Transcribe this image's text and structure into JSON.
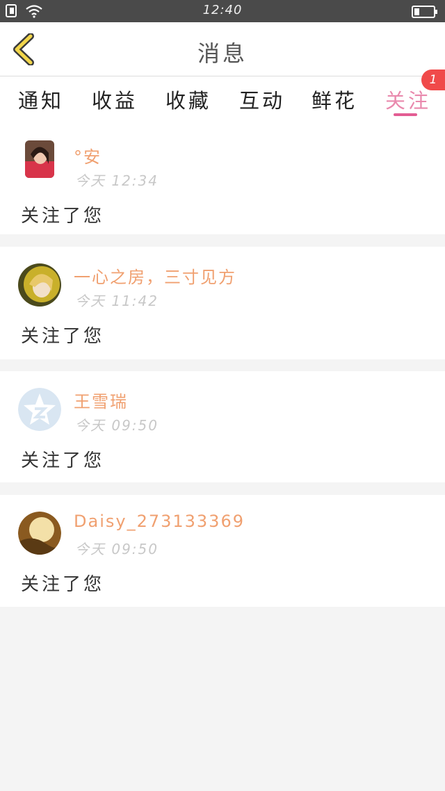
{
  "status_bar": {
    "time": "12:40",
    "icons": [
      "sim-icon",
      "wifi-icon",
      "battery-icon"
    ]
  },
  "header": {
    "title": "消息",
    "back_icon": "chevron-left-icon",
    "accent": "#f2d64b"
  },
  "tabs": [
    {
      "label": "通知"
    },
    {
      "label": "收益"
    },
    {
      "label": "收藏"
    },
    {
      "label": "互动"
    },
    {
      "label": "鲜花"
    },
    {
      "label": "关注",
      "active": true,
      "badge": "1"
    }
  ],
  "colors": {
    "active_tab": "#e989ad",
    "underline": "#e35d93",
    "badge": "#f04a4a",
    "name": "#f0a070",
    "time": "#c8c8c8"
  },
  "messages": [
    {
      "name": "°安",
      "time": "今天 12:34",
      "action": "关注了您",
      "avatar": "photo-avatar-girl"
    },
    {
      "name": "一心之房，三寸见方",
      "time": "今天 11:42",
      "action": "关注了您",
      "avatar": "photo-avatar-girl"
    },
    {
      "name": "王雪瑞",
      "time": "今天 09:50",
      "action": "关注了您",
      "avatar": "default-star-avatar"
    },
    {
      "name": "Daisy_273133369",
      "time": "今天 09:50",
      "action": "关注了您",
      "avatar": "photo-avatar-landscape"
    }
  ]
}
